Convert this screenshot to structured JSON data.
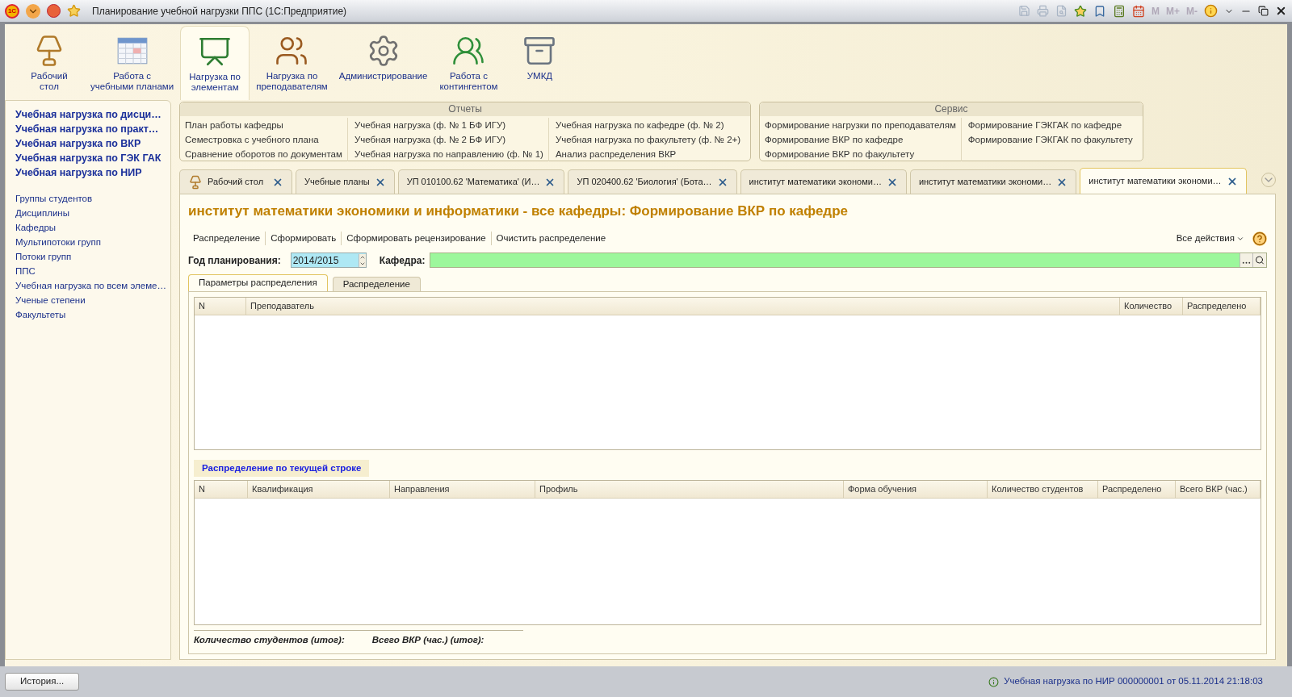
{
  "window": {
    "logo": "1С",
    "title": "Планирование учебной нагрузки ППС  (1С:Предприятие)",
    "memory_buttons": [
      "M",
      "M+",
      "M-"
    ]
  },
  "sections": [
    {
      "lines": [
        "Рабочий",
        "стол"
      ],
      "selected": false
    },
    {
      "lines": [
        "Работа с",
        "учебными планами"
      ],
      "selected": false
    },
    {
      "lines": [
        "Нагрузка по",
        "элементам"
      ],
      "selected": true
    },
    {
      "lines": [
        "Нагрузка по",
        "преподавателям"
      ],
      "selected": false
    },
    {
      "lines": [
        "Администрирование"
      ],
      "selected": false
    },
    {
      "lines": [
        "Работа с",
        "контингентом"
      ],
      "selected": false
    },
    {
      "lines": [
        "УМКД"
      ],
      "selected": false
    }
  ],
  "sidebar": {
    "bold_items": [
      "Учебная нагрузка по дисци…",
      "Учебная нагрузка по практ…",
      "Учебная нагрузка по ВКР",
      "Учебная нагрузка по ГЭК ГАК",
      "Учебная нагрузка по НИР"
    ],
    "items": [
      "Группы студентов",
      "Дисциплины",
      "Кафедры",
      "Мультипотоки групп",
      "Потоки групп",
      "ППС",
      "Учебная нагрузка по всем элеме…",
      "Ученые степени",
      "Факультеты"
    ]
  },
  "reports": {
    "title": "Отчеты",
    "columns": [
      [
        "План работы кафедры",
        "Семестровка с учебного плана",
        "Сравнение оборотов по документам"
      ],
      [
        "Учебная нагрузка (ф. № 1 БФ ИГУ)",
        "Учебная нагрузка (ф. № 2 БФ ИГУ)",
        "Учебная нагрузка по направлению (ф. № 1)"
      ],
      [
        "Учебная нагрузка по кафедре (ф. № 2)",
        "Учебная нагрузка по факультету (ф. № 2+)",
        "Анализ распределения ВКР"
      ]
    ]
  },
  "service": {
    "title": "Сервис",
    "columns": [
      [
        "Формирование нагрузки по преподавателям",
        "Формирование ВКР по кафедре",
        "Формирование ВКР по факультету"
      ],
      [
        "Формирование ГЭКГАК по кафедре",
        "Формирование ГЭКГАК по факультету"
      ]
    ]
  },
  "tabs": [
    {
      "label": "Рабочий стол",
      "kind": "desktop",
      "selected": false
    },
    {
      "label": "Учебные планы",
      "kind": "plain",
      "selected": false
    },
    {
      "label": "УП 010100.62 'Математика' (И…",
      "kind": "plain",
      "selected": false
    },
    {
      "label": "УП 020400.62 'Биология' (Бота…",
      "kind": "plain",
      "selected": false
    },
    {
      "label": "институт математики экономи…",
      "kind": "plain",
      "selected": false
    },
    {
      "label": "институт математики экономи…",
      "kind": "plain",
      "selected": false
    },
    {
      "label": "институт математики экономи…",
      "kind": "plain",
      "selected": true
    }
  ],
  "form": {
    "title": "институт математики экономики и информатики - все кафедры: Формирование ВКР по кафедре",
    "actions": [
      "Распределение",
      "Сформировать",
      "Сформировать рецензирование",
      "Очистить распределение"
    ],
    "all_actions": "Все действия",
    "year_label": "Год планирования:",
    "year_value": "2014/2015",
    "dept_label": "Кафедра:",
    "subtabs": [
      {
        "label": "Параметры распределения",
        "selected": true
      },
      {
        "label": "Распределение",
        "selected": false
      }
    ],
    "teachers_table": {
      "columns": [
        "N",
        "Преподаватель",
        "Количество",
        "Распределено"
      ]
    },
    "section_title": "Распределение по текущей строке",
    "groups_table": {
      "columns": [
        "N",
        "Квалификация",
        "Направления",
        "Профиль",
        "Форма обучения",
        "Количество студентов",
        "Распределено",
        "Всего ВКР (час.)"
      ]
    },
    "totals": [
      "Количество студентов (итог):",
      "Всего ВКР (час.) (итог):"
    ]
  },
  "status_bar": {
    "history": "История...",
    "message": "Учебная нагрузка по НИР 000000001 от 05.11.2014 21:18:03"
  }
}
